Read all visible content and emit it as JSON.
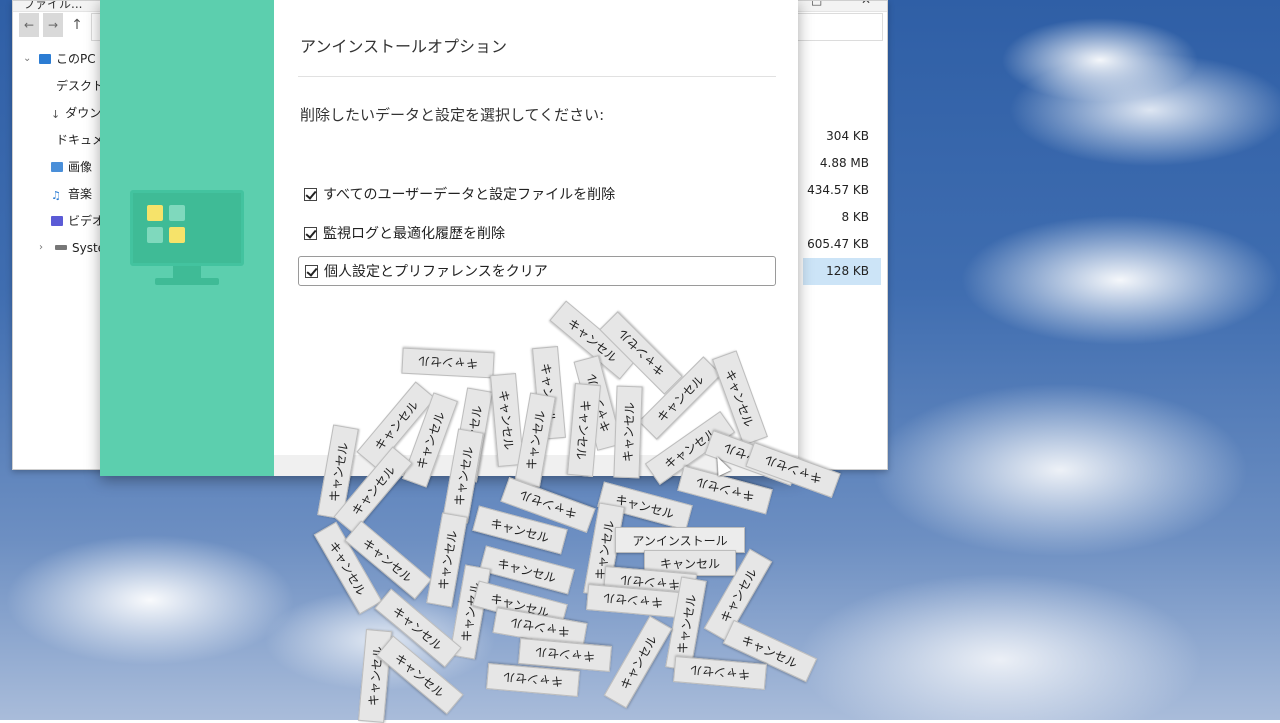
{
  "explorer": {
    "title": "ファイル...",
    "tree": [
      {
        "label": "このPC",
        "icon": "pc-icon",
        "color": "#2b7cd3"
      },
      {
        "label": "デスクトップ",
        "icon": "desktop-icon",
        "color": "#2b7cd3"
      },
      {
        "label": "ダウンロード",
        "icon": "download-icon",
        "color": "#555555"
      },
      {
        "label": "ドキュメント",
        "icon": "folder-icon",
        "color": "#f2b233"
      },
      {
        "label": "画像",
        "icon": "pictures-icon",
        "color": "#4a8fd9"
      },
      {
        "label": "音楽",
        "icon": "music-icon",
        "color": "#2b7cd3"
      },
      {
        "label": "ビデオ",
        "icon": "video-icon",
        "color": "#5b5bd6"
      },
      {
        "label": "System",
        "icon": "drive-icon",
        "color": "#777777"
      }
    ],
    "sizes": [
      "304 KB",
      "4.88 MB",
      "434.57 KB",
      "8 KB",
      "605.47 KB",
      "128 KB"
    ]
  },
  "dialog": {
    "title": "アンインストールオプション",
    "prompt": "削除したいデータと設定を選択してください:",
    "options": [
      {
        "label": "すべてのユーザーデータと設定ファイルを削除",
        "checked": true
      },
      {
        "label": "監視ログと最適化履歴を削除",
        "checked": true
      },
      {
        "label": "個人設定とプリファレンスをクリア",
        "checked": true
      }
    ],
    "accent": "#5ccfae"
  },
  "buttons": {
    "cancel_label": "キャンセル",
    "uninstall_label": "アンインストール"
  }
}
